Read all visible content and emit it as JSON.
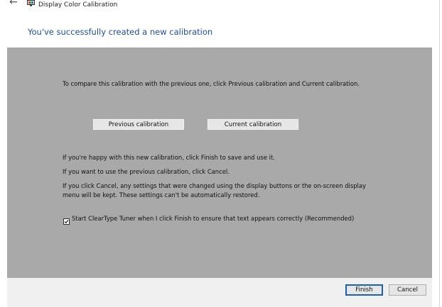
{
  "window": {
    "title": "Display Color Calibration",
    "back_icon": "back-arrow-icon",
    "app_icon": "display-color-calibration-icon"
  },
  "heading": "You've successfully created a new calibration",
  "panel": {
    "compare_text": "To compare this calibration with the previous one, click Previous calibration and Current calibration.",
    "previous_button": "Previous calibration",
    "current_button": "Current calibration",
    "happy_text": "If you're happy with this new calibration, click Finish to save and use it.",
    "previous_text": "If you want to use the previous calibration, click Cancel.",
    "cancel_note": "If you click Cancel, any settings that were changed using the display buttons or the on-screen display menu will be kept. These settings can't be automatically restored.",
    "cleartype_checkbox": {
      "checked": true,
      "label": "Start ClearType Tuner when I click Finish to ensure that text appears correctly (Recommended)"
    }
  },
  "footer": {
    "finish_button": "Finish",
    "cancel_button": "Cancel"
  },
  "colors": {
    "heading": "#1a4f9c",
    "panel_background": "#a9a9a9",
    "footer_background": "#f0f0f0",
    "default_button_border": "#1a5fb4"
  }
}
